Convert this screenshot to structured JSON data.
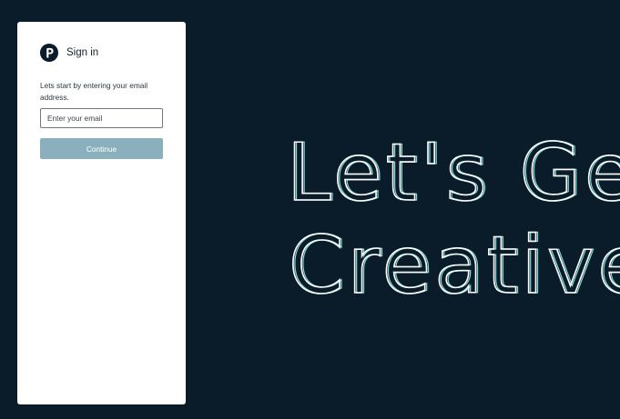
{
  "signin": {
    "title": "Sign in",
    "logo_icon": "pearson-p-logo",
    "intro_text": "Lets start by entering your email address.",
    "email": {
      "placeholder": "Enter your email",
      "value": ""
    },
    "continue_label": "Continue"
  },
  "hero": {
    "line1": "Let's Get",
    "line2": "Creative"
  },
  "colors": {
    "background": "#0a1b29",
    "panel": "#ffffff",
    "continue_button": "#8ab0bd",
    "hero_stroke": "#ffffff",
    "hero_accent": "#7fd6d6"
  }
}
